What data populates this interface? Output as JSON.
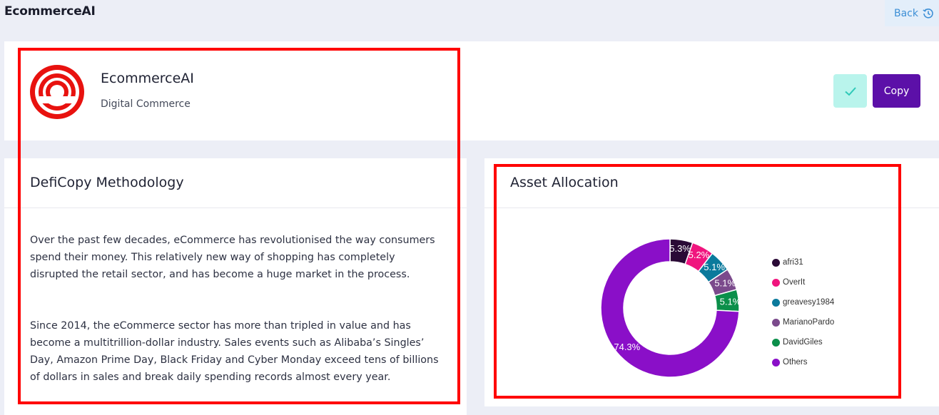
{
  "app": {
    "title": "EcommerceAI"
  },
  "header": {
    "back_label": "Back"
  },
  "profile": {
    "name": "EcommerceAI",
    "category": "Digital Commerce",
    "copy_label": "Copy"
  },
  "methodology": {
    "title": "DefiCopy Methodology",
    "paragraphs": [
      "Over the past few decades, eCommerce has revolutionised the way consumers spend their money. This relatively new way of shopping has completely disrupted the retail sector, and has become a huge market in the process.",
      "Since 2014, the eCommerce sector has more than tripled in value and has become a multitrillion-dollar industry. Sales events such as Alibaba’s Singles’ Day, Amazon Prime Day, Black Friday and Cyber Monday exceed tens of billions of dollars in sales and break daily spending records almost every year."
    ]
  },
  "allocation": {
    "title": "Asset Allocation"
  },
  "chart_data": {
    "type": "pie",
    "categories": [
      "afri31",
      "OverIt",
      "greavesy1984",
      "MarianoPardo",
      "DavidGiles",
      "Others"
    ],
    "values": [
      5.3,
      5.2,
      5.1,
      5.1,
      5.1,
      74.3
    ],
    "labels": [
      "5.3%",
      "5.2%",
      "5.1%",
      "5.1%",
      "5.1%",
      "74.3%"
    ],
    "colors": [
      "#2a0a36",
      "#f0157e",
      "#0b7a9c",
      "#7b4a8c",
      "#0b8f4a",
      "#8a0fc8"
    ],
    "donut": true,
    "legend": "right"
  }
}
